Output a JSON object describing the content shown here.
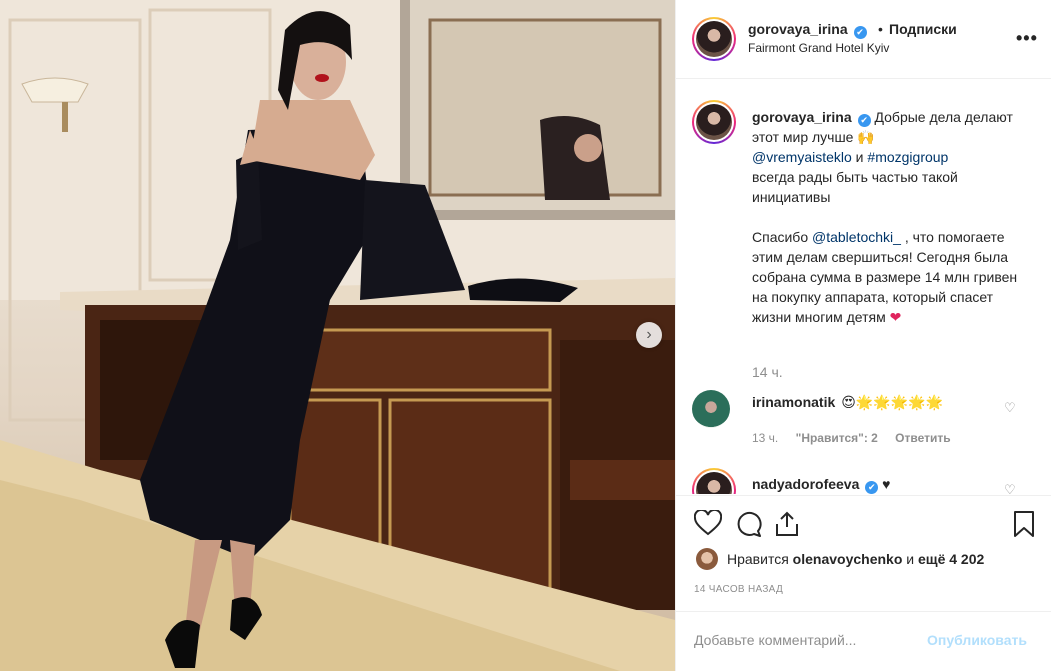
{
  "header": {
    "username": "gorovaya_irina",
    "verified_mark": "✔",
    "separator": "•",
    "follow_label": "Подписки",
    "location": "Fairmont Grand Hotel Kyiv",
    "more_icon": "•••"
  },
  "photo": {
    "next_icon": "›"
  },
  "caption": {
    "username": "gorovaya_irina",
    "line1": "Добрые дела делают этот мир лучше 🙌",
    "mention1": "@vremyaisteklo",
    "and": " и ",
    "hashtag": "#mozgigroup",
    "line2": "всегда рады быть частью такой инициативы",
    "thanks_pre": "Спасибо ",
    "mention2": "@tabletochki_",
    "thanks_post": " , что помогаете этим делам свершиться! Сегодня была собрана сумма в размере 14 млн гривен на покупку аппарата, который спасет жизни многим детям ",
    "heart": "❤",
    "time": "14 ч."
  },
  "comments": [
    {
      "username": "irinamonatik",
      "text": "😍🌟🌟🌟🌟🌟",
      "time": "13 ч.",
      "likes": "\"Нравится\": 2",
      "reply": "Ответить"
    },
    {
      "username": "nadyadorofeeva",
      "text": "♥"
    }
  ],
  "likes": {
    "prefix": "Нравится ",
    "user": "olenavoychenko",
    "middle": " и ",
    "count": "ещё 4 202"
  },
  "timestamp": "14 ЧАСОВ НАЗАД",
  "add_comment": {
    "placeholder": "Добавьте комментарий...",
    "publish": "Опубликовать"
  },
  "colors": {
    "link": "#003569",
    "verified": "#3897f0",
    "heart": "#e0245e",
    "publish_disabled": "#b2dffc"
  }
}
